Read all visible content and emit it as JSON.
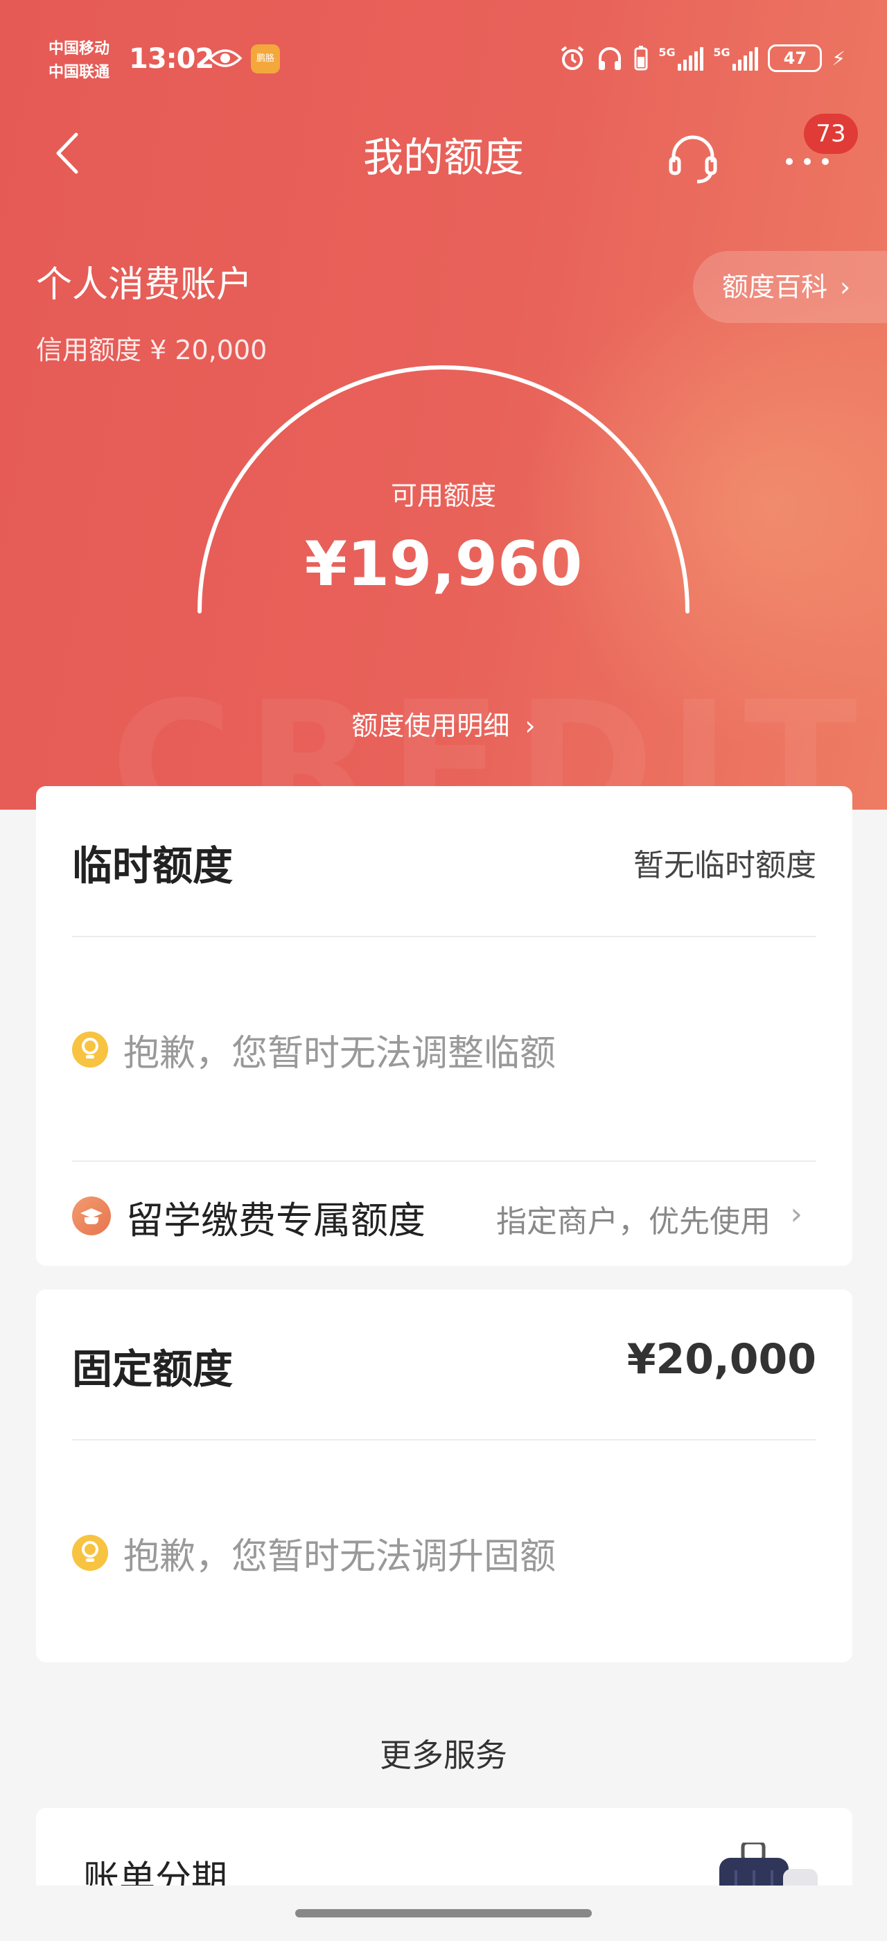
{
  "status_bar": {
    "carrier_1": "中国移动",
    "carrier_2": "中国联通",
    "time": "13:02",
    "app_badge": "鹏胳",
    "network_1": "5G",
    "network_2": "5G",
    "battery": "47"
  },
  "nav": {
    "title": "我的额度",
    "message_count": "73"
  },
  "account": {
    "name": "个人消费账户",
    "credit_limit": "信用额度 ¥ 20,000",
    "encyclopedia_label": "额度百科"
  },
  "gauge": {
    "label": "可用额度",
    "value": "¥19,960",
    "usage_link": "额度使用明细",
    "watermark": "CREDIT"
  },
  "temp_limit": {
    "title": "临时额度",
    "status": "暂无临时额度",
    "tip": "抱歉，您暂时无法调整临额",
    "study_title": "留学缴费专属额度",
    "study_desc": "指定商户，优先使用"
  },
  "fixed_limit": {
    "title": "固定额度",
    "amount": "¥20,000",
    "tip": "抱歉，您暂时无法调升固额"
  },
  "more_services": {
    "section_title": "更多服务",
    "first_item": "账单分期"
  },
  "colors": {
    "brand_red": "#e65a55",
    "bulb_yellow": "#f7c340",
    "cap_orange": "#ee8860"
  }
}
